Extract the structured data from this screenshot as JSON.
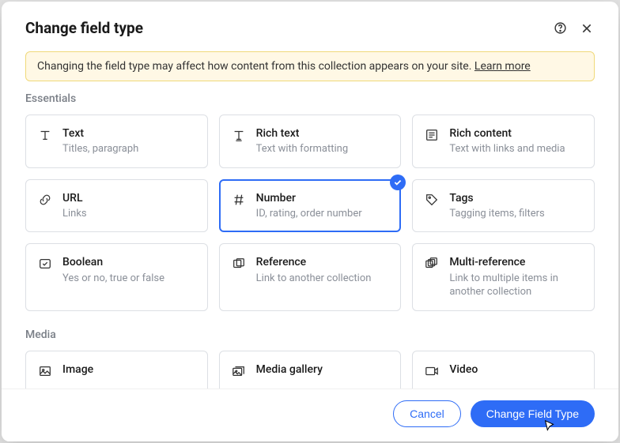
{
  "header": {
    "title": "Change field type"
  },
  "warning": {
    "text": "Changing the field type may affect how content from this collection appears on your site. ",
    "link_text": "Learn more"
  },
  "sections": {
    "essentials": {
      "label": "Essentials",
      "items": [
        {
          "name": "Text",
          "desc": "Titles, paragraph",
          "icon": "text"
        },
        {
          "name": "Rich text",
          "desc": "Text with formatting",
          "icon": "richtext"
        },
        {
          "name": "Rich content",
          "desc": "Text with links and media",
          "icon": "richcontent"
        },
        {
          "name": "URL",
          "desc": "Links",
          "icon": "url"
        },
        {
          "name": "Number",
          "desc": "ID, rating, order number",
          "icon": "number",
          "selected": true
        },
        {
          "name": "Tags",
          "desc": "Tagging items, filters",
          "icon": "tags"
        },
        {
          "name": "Boolean",
          "desc": "Yes or no, true or false",
          "icon": "boolean"
        },
        {
          "name": "Reference",
          "desc": "Link to another collection",
          "icon": "reference"
        },
        {
          "name": "Multi-reference",
          "desc": "Link to multiple items in another collection",
          "icon": "multireference"
        }
      ]
    },
    "media": {
      "label": "Media",
      "items": [
        {
          "name": "Image",
          "desc": "",
          "icon": "image"
        },
        {
          "name": "Media gallery",
          "desc": "",
          "icon": "gallery"
        },
        {
          "name": "Video",
          "desc": "",
          "icon": "video"
        }
      ]
    }
  },
  "footer": {
    "cancel": "Cancel",
    "confirm": "Change Field Type"
  }
}
